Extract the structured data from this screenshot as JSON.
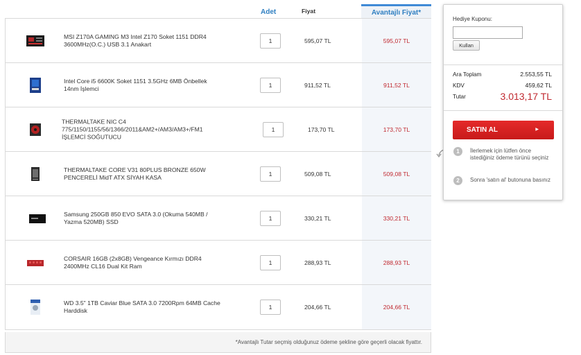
{
  "table": {
    "headers": {
      "qty": "Adet",
      "price": "Fiyat",
      "advantage_price": "Avantajlı Fiyat*"
    },
    "products": [
      {
        "name": "MSI Z170A GAMING M3 Intel Z170 Soket 1151 DDR4 3600MHz(O.C.) USB 3.1 Anakart",
        "qty": "1",
        "price": "595,07 TL",
        "advantage_price": "595,07 TL",
        "icon": "motherboard-icon"
      },
      {
        "name": "Intel Core i5 6600K Soket 1151 3.5GHz 6MB Önbellek 14nm İşlemci",
        "qty": "1",
        "price": "911,52 TL",
        "advantage_price": "911,52 TL",
        "icon": "cpu-box-icon"
      },
      {
        "name": "THERMALTAKE NIC C4 775/1150/1155/56/1366/2011&AM2+/AM3/AM3+/FM1 İŞLEMCİ SOĞUTUCU",
        "qty": "1",
        "price": "173,70 TL",
        "advantage_price": "173,70 TL",
        "icon": "cpu-cooler-icon"
      },
      {
        "name": "THERMALTAKE CORE V31 80PLUS BRONZE 650W PENCERELİ MidT ATX SİYAH KASA",
        "qty": "1",
        "price": "509,08 TL",
        "advantage_price": "509,08 TL",
        "icon": "pc-case-icon"
      },
      {
        "name": "Samsung 250GB 850 EVO SATA 3.0 (Okuma 540MB / Yazma 520MB) SSD",
        "qty": "1",
        "price": "330,21 TL",
        "advantage_price": "330,21 TL",
        "icon": "ssd-icon"
      },
      {
        "name": "CORSAIR 16GB (2x8GB) Vengeance Kırmızı DDR4 2400MHz CL16 Dual Kit Ram",
        "qty": "1",
        "price": "288,93 TL",
        "advantage_price": "288,93 TL",
        "icon": "ram-icon"
      },
      {
        "name": "WD 3.5\" 1TB Caviar Blue SATA 3.0 7200Rpm 64MB Cache Harddisk",
        "qty": "1",
        "price": "204,66 TL",
        "advantage_price": "204,66 TL",
        "icon": "hard-disk-icon"
      }
    ],
    "footnote": "*Avantajlı Tutar seçmiş olduğunuz ödeme şekline göre geçerli olacak fiyattır."
  },
  "summary": {
    "coupon_label": "Hediye Kuponu:",
    "coupon_value": "",
    "apply_label": "Kullan",
    "subtotal_label": "Ara Toplam",
    "subtotal_value": "2.553,55 TL",
    "tax_label": "KDV",
    "tax_value": "459,62 TL",
    "total_label": "Tutar",
    "total_value": "3.013,17 TL",
    "buy_label": "SATIN AL",
    "steps": [
      {
        "num": "1",
        "text": "İlerlemek için lütfen önce istediğiniz ödeme türünü seçiniz"
      },
      {
        "num": "2",
        "text": "Sonra 'satın al' butonuna basınız"
      }
    ]
  },
  "colors": {
    "accent_blue": "#2f7fc1",
    "price_red": "#c0282f",
    "buy_red": "#d62020"
  }
}
